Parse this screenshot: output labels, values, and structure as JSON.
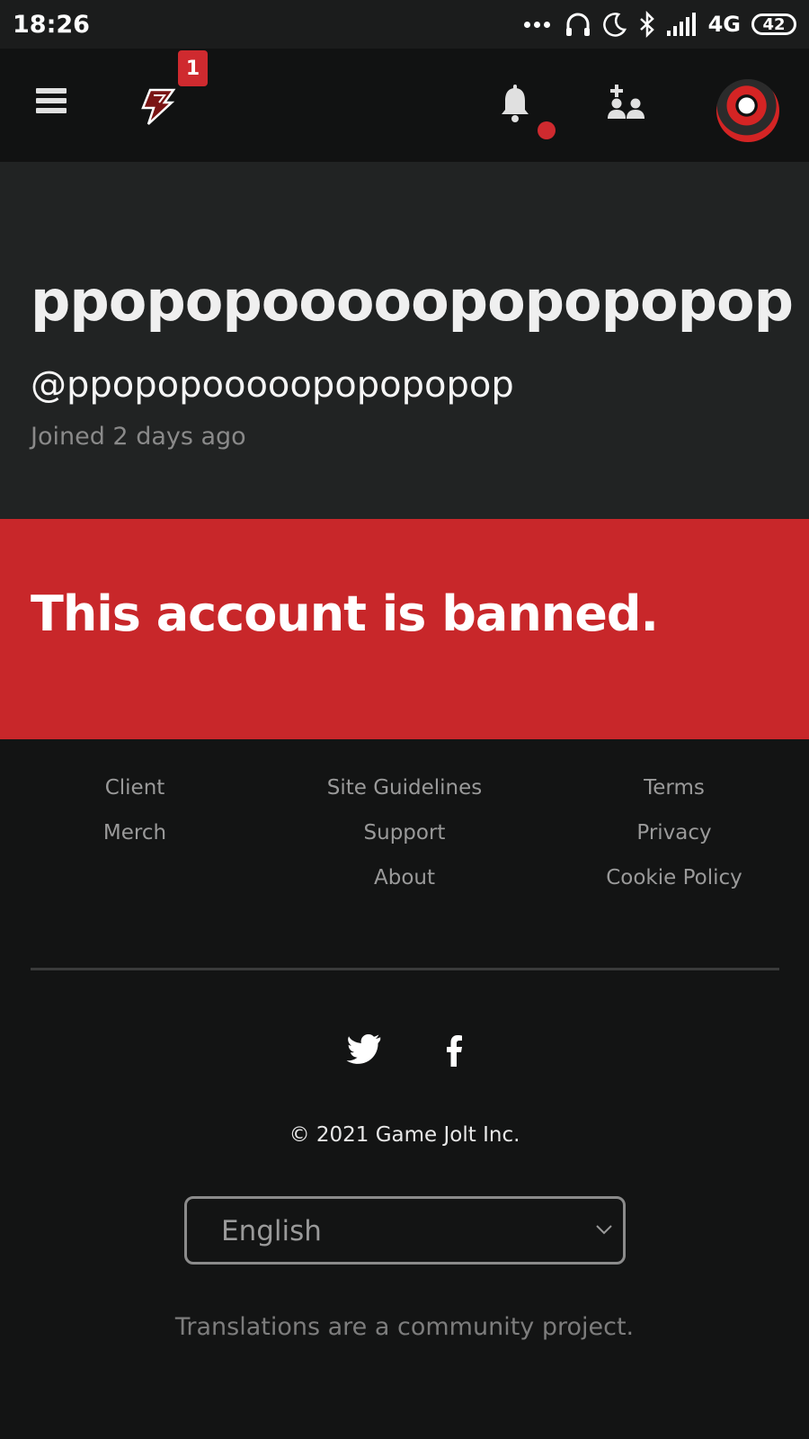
{
  "status_bar": {
    "time": "18:26",
    "network": "4G",
    "battery": "42",
    "icons": [
      "dots-icon",
      "headphones-icon",
      "moon-icon",
      "bluetooth-icon",
      "signal-icon"
    ]
  },
  "top_nav": {
    "menu_icon": "hamburger-icon",
    "logo_icon": "gamejolt-logo-icon",
    "logo_badge": "1",
    "notifications_icon": "bell-icon",
    "friends_icon": "friend-requests-icon",
    "avatar_icon": "user-avatar"
  },
  "profile": {
    "display_name": "ppopopooooopopopopop",
    "username": "@ppopopooooopopopopop",
    "joined": "Joined 2 days ago"
  },
  "banned_notice": "This account is banned.",
  "footer": {
    "col1": [
      "Client",
      "Merch"
    ],
    "col2": [
      "Site Guidelines",
      "Support",
      "About"
    ],
    "col3": [
      "Terms",
      "Privacy",
      "Cookie Policy"
    ],
    "social": [
      "twitter-icon",
      "facebook-icon"
    ],
    "copyright": "© 2021 Game Jolt Inc.",
    "language": "English",
    "translations_note": "Translations are a community project."
  },
  "colors": {
    "accent_red": "#c8272a",
    "badge_red": "#cf2a2f",
    "background": "#131414",
    "header_bg": "#212323"
  }
}
